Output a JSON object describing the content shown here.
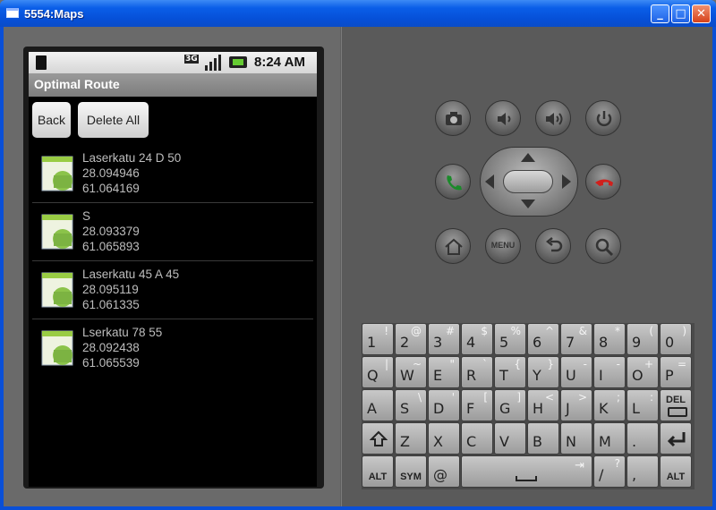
{
  "window": {
    "title": "5554:Maps"
  },
  "statusbar": {
    "network": "3G",
    "time": "8:24 AM"
  },
  "app": {
    "title": "Optimal Route",
    "back_label": "Back",
    "delete_all_label": "Delete All"
  },
  "routes": [
    {
      "name": "Laserkatu 24 D 50",
      "lon": "28.094946",
      "lat": "61.064169"
    },
    {
      "name": "S",
      "lon": "28.093379",
      "lat": "61.065893"
    },
    {
      "name": "Laserkatu 45 A 45",
      "lon": "28.095119",
      "lat": "61.061335"
    },
    {
      "name": "Lserkatu 78 55",
      "lon": "28.092438",
      "lat": "61.065539"
    }
  ],
  "controls": {
    "menu_label": "MENU"
  },
  "keyboard": {
    "row1": [
      [
        "1",
        "!"
      ],
      [
        "2",
        "@"
      ],
      [
        "3",
        "#"
      ],
      [
        "4",
        "$"
      ],
      [
        "5",
        "%"
      ],
      [
        "6",
        "^"
      ],
      [
        "7",
        "&"
      ],
      [
        "8",
        "*"
      ],
      [
        "9",
        "("
      ],
      [
        "0",
        ")"
      ]
    ],
    "row2": [
      [
        "Q",
        "|"
      ],
      [
        "W",
        "~"
      ],
      [
        "E",
        "\""
      ],
      [
        "R",
        "`"
      ],
      [
        "T",
        "{"
      ],
      [
        "Y",
        "}"
      ],
      [
        "U",
        "-"
      ],
      [
        "I",
        "-"
      ],
      [
        "O",
        "+"
      ],
      [
        "P",
        "="
      ]
    ],
    "row3": [
      [
        "A",
        ""
      ],
      [
        "S",
        "\\"
      ],
      [
        "D",
        "'"
      ],
      [
        "F",
        "["
      ],
      [
        "G",
        "]"
      ],
      [
        "H",
        "<"
      ],
      [
        "J",
        ">"
      ],
      [
        "K",
        ";"
      ],
      [
        "L",
        ":"
      ]
    ],
    "del_label": "DEL",
    "row4": [
      [
        "Z"
      ],
      [
        "X"
      ],
      [
        "C"
      ],
      [
        "V"
      ],
      [
        "B"
      ],
      [
        "N"
      ],
      [
        "M"
      ],
      [
        "."
      ]
    ],
    "alt_label": "ALT",
    "sym_label": "SYM",
    "at_label": "@",
    "slash_label": "/",
    "slash_sup": "?",
    "comma_label": ","
  }
}
